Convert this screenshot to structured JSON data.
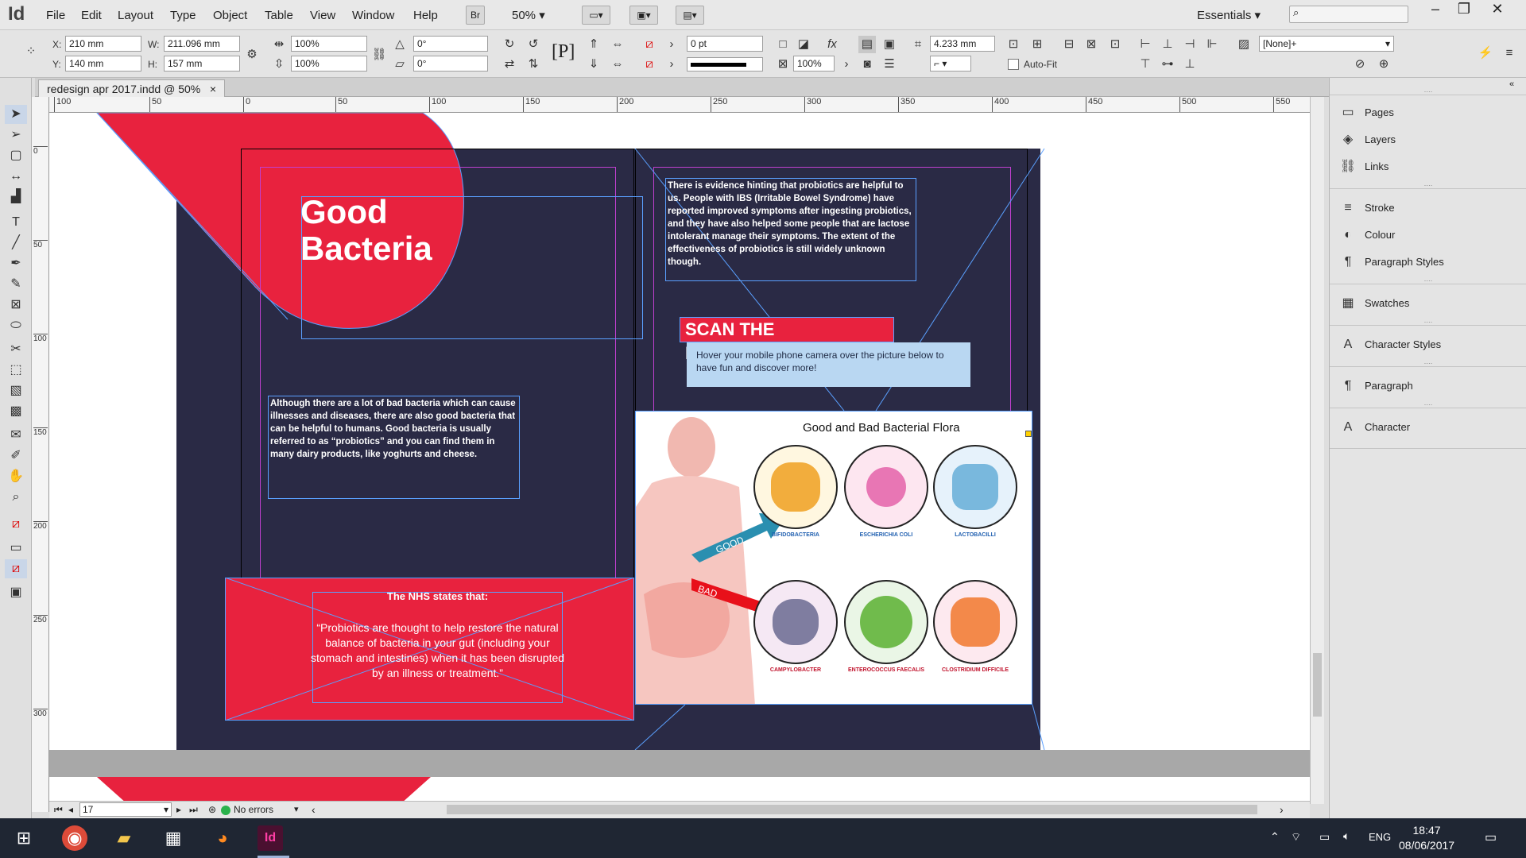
{
  "app": {
    "logo": "Id",
    "zoom": "50%",
    "workspace": "Essentials",
    "bridge": "Br"
  },
  "menu": [
    "File",
    "Edit",
    "Layout",
    "Type",
    "Object",
    "Table",
    "View",
    "Window",
    "Help"
  ],
  "control": {
    "x_label": "X:",
    "x": "210 mm",
    "y_label": "Y:",
    "y": "140 mm",
    "w_label": "W:",
    "w": "211.096 mm",
    "h_label": "H:",
    "h": "157 mm",
    "scale_x": "100%",
    "scale_y": "100%",
    "rotate": "0°",
    "shear": "0°",
    "stroke_weight": "0 pt",
    "opacity": "100%",
    "gap": "4.233 mm",
    "object_style": "[None]+",
    "autofit": "Auto-Fit"
  },
  "document": {
    "tab_title": "redesign apr 2017.indd @ 50%",
    "close": "×"
  },
  "ruler": {
    "h": [
      "100",
      "50",
      "0",
      "50",
      "100",
      "150",
      "200",
      "250",
      "300",
      "350",
      "400",
      "450",
      "500",
      "550"
    ],
    "v": [
      "0",
      "50",
      "100",
      "150",
      "200",
      "250",
      "300"
    ]
  },
  "page": {
    "title_line1": "Good",
    "title_line2": "Bacteria",
    "body_left": "Although there are a lot of bad bacteria which can cause illnesses and diseases, there are also good bacteria that can be helpful to humans. Good bacteria is usually referred to as “probiotics” and you can find them in many dairy products, like yoghurts and cheese.",
    "body_right": "There is evidence hinting that probiotics are helpful to us. People with IBS (Irritable Bowel Syndrome) have reported improved symptoms after ingesting probiotics, and they have also helped some people that are lactose intolerant manage their symptoms. The extent of the effectiveness of probiotics is still widely unknown though.",
    "nhs_heading": "The NHS states that:",
    "nhs_quote": "“Probiotics are thought to help restore the natural balance of bacteria in your gut (including your stomach and intestines) when it has been disrupted by an illness or treatment.”",
    "scan_banner": "SCAN THE INFOGRAPHIC!",
    "hover_text": "Hover your mobile phone camera over the picture below to have fun and discover more!",
    "infographic_title": "Good and Bad Bacterial Flora",
    "good_label": "GOOD",
    "bad_label": "BAD",
    "microbes": [
      {
        "name": "BIFIDOBACTERIA",
        "color": "#f0a020"
      },
      {
        "name": "ESCHERICHIA COLI",
        "color": "#e050a0"
      },
      {
        "name": "LACTOBACILLI",
        "color": "#4aa0d0"
      },
      {
        "name": "CAMPYLOBACTER",
        "color": "#6a6a90"
      },
      {
        "name": "ENTEROCOCCUS FAECALIS",
        "color": "#5ab030"
      },
      {
        "name": "CLOSTRIDIUM DIFFICILE",
        "color": "#f07020"
      }
    ]
  },
  "status": {
    "page_num": "17",
    "errors": "No errors"
  },
  "panels": [
    {
      "label": "Pages",
      "icon": "pages-icon",
      "glyph": "▭"
    },
    {
      "label": "Layers",
      "icon": "layers-icon",
      "glyph": "◈"
    },
    {
      "label": "Links",
      "icon": "links-icon",
      "glyph": "⛓"
    },
    {
      "label": "Stroke",
      "icon": "stroke-icon",
      "glyph": "≡"
    },
    {
      "label": "Colour",
      "icon": "colour-icon",
      "glyph": "◐"
    },
    {
      "label": "Paragraph Styles",
      "icon": "paragraph-styles-icon",
      "glyph": "¶"
    },
    {
      "label": "Swatches",
      "icon": "swatches-icon",
      "glyph": "▦"
    },
    {
      "label": "Character Styles",
      "icon": "character-styles-icon",
      "glyph": "A"
    },
    {
      "label": "Paragraph",
      "icon": "paragraph-icon",
      "glyph": "¶"
    },
    {
      "label": "Character",
      "icon": "character-icon",
      "glyph": "A"
    }
  ],
  "taskbar": {
    "time": "18:47",
    "date": "08/06/2017",
    "lang": "ENG"
  }
}
